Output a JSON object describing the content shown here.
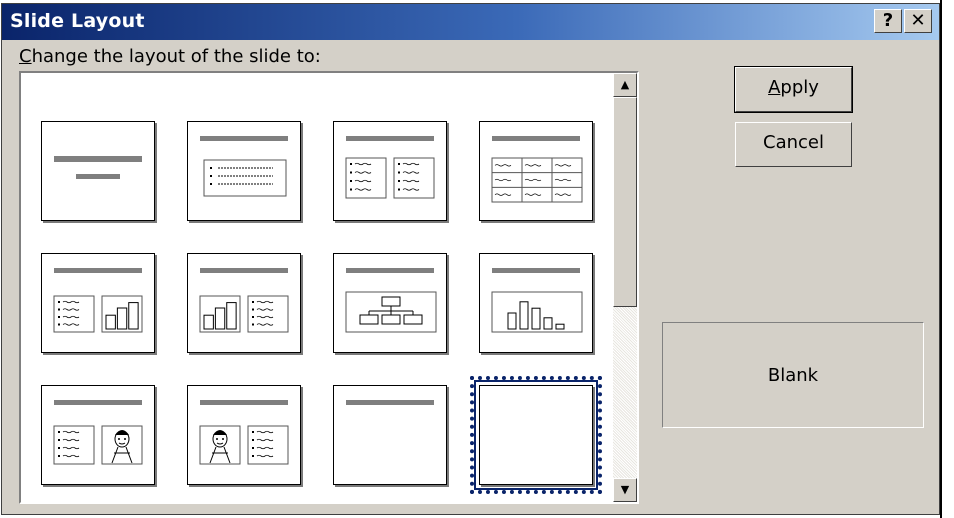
{
  "window": {
    "title": "Slide Layout",
    "help_button": "?",
    "close_button": "✕"
  },
  "prompt": {
    "mnemonic": "C",
    "rest": "hange the layout of the slide to:"
  },
  "buttons": {
    "apply_mnemonic": "A",
    "apply_rest": "pply",
    "cancel": "Cancel"
  },
  "layouts": [
    {
      "name": "title-slide",
      "selected": false
    },
    {
      "name": "bulleted-list",
      "selected": false
    },
    {
      "name": "two-column-text",
      "selected": false
    },
    {
      "name": "table",
      "selected": false
    },
    {
      "name": "text-and-chart",
      "selected": false
    },
    {
      "name": "chart-and-text",
      "selected": false
    },
    {
      "name": "organization-chart",
      "selected": false
    },
    {
      "name": "chart",
      "selected": false
    },
    {
      "name": "text-and-clip-art",
      "selected": false
    },
    {
      "name": "clip-art-and-text",
      "selected": false
    },
    {
      "name": "title-only",
      "selected": false
    },
    {
      "name": "blank",
      "selected": true
    }
  ],
  "preview": {
    "label": "Blank"
  },
  "scrollbar": {
    "up_arrow": "▲",
    "down_arrow": "▼"
  },
  "colors": {
    "title_bar": "#0a246a",
    "dialog_face": "#d4d0c8",
    "selection": "#0a246a"
  }
}
